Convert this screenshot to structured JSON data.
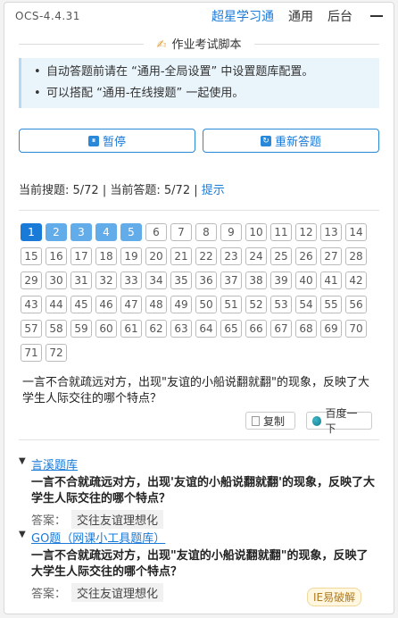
{
  "header": {
    "version": "OCS-4.4.31",
    "nav": [
      "超星学习通",
      "通用",
      "后台"
    ]
  },
  "section": {
    "title": "作业考试脚本",
    "icon": "pen-icon"
  },
  "notice": [
    "自动答题前请在 “通用-全局设置” 中设置题库配置。",
    "可以搭配 “通用-在线搜题” 一起使用。"
  ],
  "buttons": {
    "pause": "暂停",
    "redo": "重新答题"
  },
  "status": {
    "search": "当前搜题: 5/72",
    "separator": "|",
    "answer": "当前答题: 5/72",
    "hint": "提示"
  },
  "progress": {
    "total": 72,
    "current": 1,
    "done": [
      2,
      3,
      4,
      5
    ]
  },
  "question": {
    "text": "一言不合就疏远对方，出现\"友谊的小船说翻就翻\"的现象，反映了大学生人际交往的哪个特点？",
    "copy": "复制",
    "baidu": "百度一下"
  },
  "results": [
    {
      "source": "言溪题库",
      "question": "一言不合就疏远对方，出现'友谊的小船说翻就翻'的现象，反映了大学生人际交往的哪个特点？",
      "answer_label": "答案：",
      "answer": "交往友谊理想化"
    },
    {
      "source": "GO题（网课小工具题库）",
      "question": "一言不合就疏远对方，出现\"友谊的小船说翻就翻\"的现象，反映了大学生人际交往的哪个特点？",
      "answer_label": "答案：",
      "answer": "交往友谊理想化"
    }
  ],
  "watermark": "IE易破解",
  "colors": {
    "accent": "#1a7ad8",
    "done": "#63acea",
    "notice_bg": "#e9f4fb"
  }
}
